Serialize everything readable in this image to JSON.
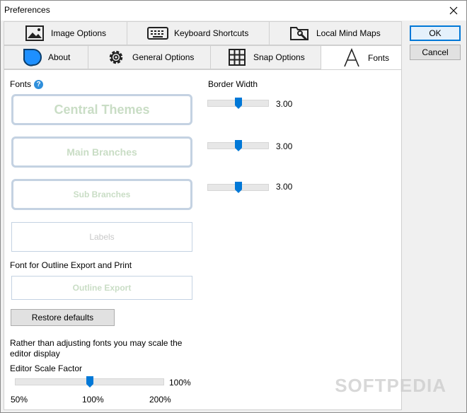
{
  "window": {
    "title": "Preferences"
  },
  "tabs_top": [
    {
      "label": "Image Options",
      "icon": "image-icon"
    },
    {
      "label": "Keyboard Shortcuts",
      "icon": "keyboard-icon"
    },
    {
      "label": "Local Mind Maps",
      "icon": "folder-wrench-icon"
    }
  ],
  "tabs_bottom": [
    {
      "label": "About",
      "icon": "about-icon"
    },
    {
      "label": "General Options",
      "icon": "gear-icon"
    },
    {
      "label": "Snap Options",
      "icon": "grid-icon"
    },
    {
      "label": "Fonts",
      "icon": "font-icon",
      "active": true
    }
  ],
  "buttons": {
    "ok": "OK",
    "cancel": "Cancel",
    "restore": "Restore defaults"
  },
  "fonts": {
    "heading": "Fonts",
    "help": "?",
    "central": "Central Themes",
    "main": "Main Branches",
    "sub": "Sub Branches",
    "labels": "Labels",
    "outline_heading": "Font for Outline Export and Print",
    "outline": "Outline Export"
  },
  "border_width": {
    "heading": "Border Width",
    "values": [
      "3.00",
      "3.00",
      "3.00"
    ],
    "levels": [
      0.5,
      0.5,
      0.5
    ]
  },
  "scale": {
    "note": "Rather than adjusting fonts you may scale the editor display",
    "heading": "Editor Scale Factor",
    "value": "100%",
    "level": 0.5,
    "ticks": [
      "50%",
      "100%",
      "200%"
    ]
  },
  "watermark": "SOFTPEDIA",
  "colors": {
    "accent": "#0078d7",
    "font_box_border": "#c4d2e2",
    "font_text": "#c9ddc5"
  }
}
